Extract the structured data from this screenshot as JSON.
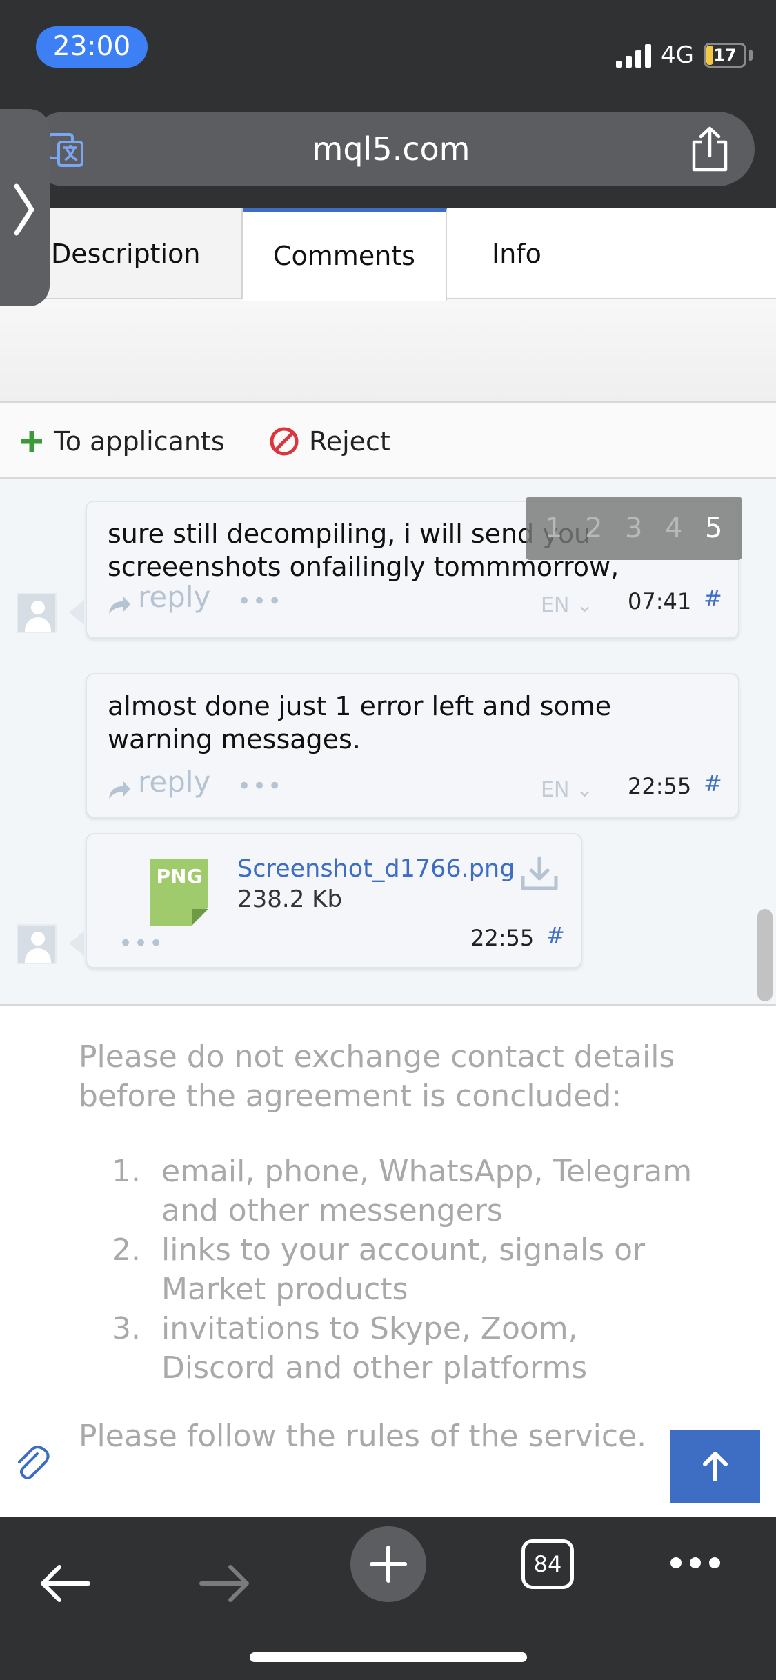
{
  "status_bar": {
    "time": "23:00",
    "network": "4G",
    "battery": "17"
  },
  "browser": {
    "url": "mql5.com",
    "tab_count": "84"
  },
  "tabs": [
    {
      "label": "Description"
    },
    {
      "label": "Comments"
    },
    {
      "label": "Info"
    }
  ],
  "actions": {
    "applicants": "To applicants",
    "reject": "Reject"
  },
  "pager": {
    "pages": [
      "1",
      "2",
      "3",
      "4",
      "5"
    ],
    "current": "5"
  },
  "messages": [
    {
      "text": "sure still decompiling, i will send you screeenshots onfailingly tommmorrow,",
      "reply": "reply",
      "more": "•••",
      "lang": "EN",
      "time": "07:41",
      "hash": "#"
    },
    {
      "text": "almost done just 1 error left and some warning messages.",
      "reply": "reply",
      "more": "•••",
      "lang": "EN",
      "time": "22:55",
      "hash": "#"
    }
  ],
  "attachment": {
    "ext": "PNG",
    "name": "Screenshot_d1766.png",
    "size": "238.2 Kb",
    "more": "•••",
    "time": "22:55",
    "hash": "#"
  },
  "notice": {
    "intro": "Please do not exchange contact details before the agreement is concluded:",
    "items": [
      {
        "num": "1.",
        "text": "email, phone, WhatsApp, Telegram and other messengers"
      },
      {
        "num": "2.",
        "text": "links to your account, signals or Market products"
      },
      {
        "num": "3.",
        "text": "invitations to Skype, Zoom, Discord and other platforms"
      }
    ],
    "placeholder": "Please follow the rules of the service."
  },
  "colors": {
    "accent": "#3d6ec4",
    "time_pill": "#3d7ff5",
    "chrome": "#303133",
    "file_icon": "#9fcb6c",
    "reject": "#d9363e",
    "plus": "#3a9a3a"
  }
}
